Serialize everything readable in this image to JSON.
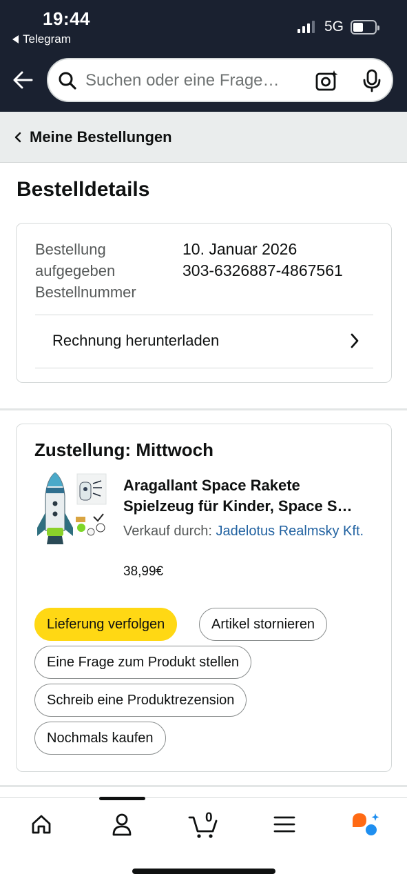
{
  "status_bar": {
    "time": "19:44",
    "back_app": "Telegram",
    "network": "5G"
  },
  "header": {
    "search_placeholder": "Suchen oder eine Frage…"
  },
  "breadcrumb": {
    "label": "Meine Bestellungen"
  },
  "page": {
    "title": "Bestelldetails"
  },
  "order": {
    "placed_label": "Bestellung aufgegeben",
    "placed_value": "10. Januar 2026",
    "number_label": "Bestellnummer",
    "number_value": "303-6326887-4867561",
    "invoice_label": "Rechnung herunterladen"
  },
  "shipment": {
    "delivery_label": "Zustellung: Mittwoch",
    "product_title_line1": "Aragallant Space Rakete",
    "product_title_line2": "Spielzeug für Kinder, Space S…",
    "seller_prefix": "Verkauf durch:",
    "seller_name": "Jadelotus Realmsky Kft.",
    "price": "38,99€",
    "buttons": {
      "track": "Lieferung verfolgen",
      "cancel": "Artikel stornieren",
      "ask": "Eine Frage zum Produkt stellen",
      "review": "Schreib eine Produktrezension",
      "rebuy": "Nochmals kaufen"
    }
  },
  "tabbar": {
    "cart_count": "0"
  },
  "colors": {
    "header_bg": "#1a2130",
    "primary_button": "#ffd814",
    "link": "#2162a1",
    "assistant_orange": "#ff6a14",
    "assistant_blue": "#1f8ff0"
  },
  "icons": [
    "back-arrow-icon",
    "search-icon",
    "camera-sparkle-icon",
    "microphone-icon",
    "chevron-left-icon",
    "chevron-right-icon",
    "home-icon",
    "account-icon",
    "cart-icon",
    "menu-icon",
    "assistant-icon"
  ]
}
